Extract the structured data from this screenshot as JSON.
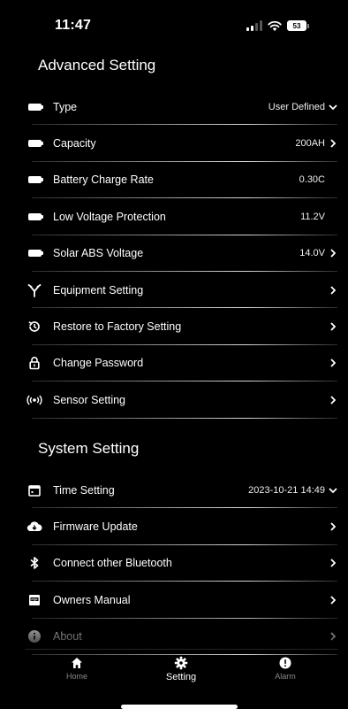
{
  "status": {
    "time": "11:47",
    "battery": "53"
  },
  "advanced": {
    "title": "Advanced Setting",
    "items": [
      {
        "icon": "battery-icon",
        "label": "Type",
        "value": "User Defined",
        "chevron": "down"
      },
      {
        "icon": "battery-icon",
        "label": "Capacity",
        "value": "200AH",
        "chevron": "right"
      },
      {
        "icon": "battery-icon",
        "label": "Battery Charge Rate",
        "value": "0.30C",
        "chevron": "none"
      },
      {
        "icon": "battery-icon",
        "label": "Low Voltage Protection",
        "value": "11.2V",
        "chevron": "none"
      },
      {
        "icon": "battery-icon",
        "label": "Solar ABS Voltage",
        "value": "14.0V",
        "chevron": "right"
      },
      {
        "icon": "equipment-icon",
        "label": "Equipment Setting",
        "value": "",
        "chevron": "right"
      },
      {
        "icon": "restore-icon",
        "label": "Restore to Factory Setting",
        "value": "",
        "chevron": "right"
      },
      {
        "icon": "lock-icon",
        "label": "Change Password",
        "value": "",
        "chevron": "right"
      },
      {
        "icon": "sensor-icon",
        "label": "Sensor Setting",
        "value": "",
        "chevron": "right"
      }
    ]
  },
  "system": {
    "title": "System Setting",
    "items": [
      {
        "icon": "calendar-icon",
        "label": "Time Setting",
        "value": "2023-10-21 14:49",
        "chevron": "down"
      },
      {
        "icon": "cloud-download-icon",
        "label": "Firmware Update",
        "value": "",
        "chevron": "right"
      },
      {
        "icon": "bluetooth-icon",
        "label": "Connect other Bluetooth",
        "value": "",
        "chevron": "right"
      },
      {
        "icon": "pdf-icon",
        "label": "Owners Manual",
        "value": "",
        "chevron": "right"
      },
      {
        "icon": "info-icon",
        "label": "About",
        "value": "",
        "chevron": "right"
      }
    ]
  },
  "tabs": [
    {
      "label": "Home",
      "icon": "home-icon",
      "active": false
    },
    {
      "label": "Setting",
      "icon": "gear-icon",
      "active": true
    },
    {
      "label": "Alarm",
      "icon": "alert-icon",
      "active": false
    }
  ]
}
